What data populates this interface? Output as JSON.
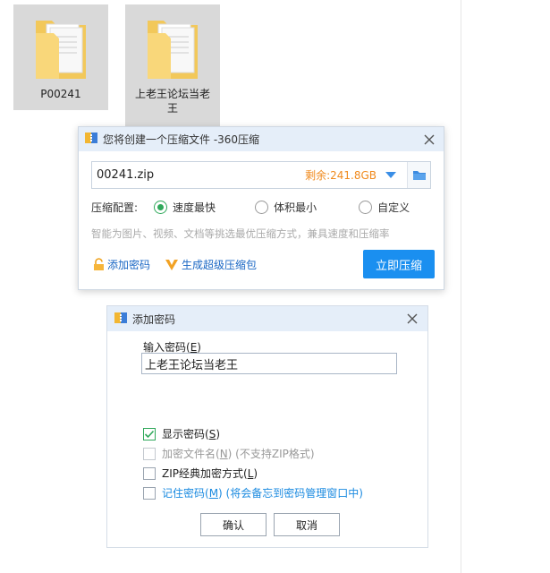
{
  "desktop": {
    "files": [
      {
        "label": "P00241",
        "icon": "folder-icon"
      },
      {
        "label": "上老王论坛当老王",
        "icon": "folder-icon"
      }
    ]
  },
  "zip_dialog": {
    "title": "您将创建一个压缩文件 -360压缩",
    "filename": "00241.zip",
    "free_space": "剩余:241.8GB",
    "config_label": "压缩配置:",
    "options": [
      "速度最快",
      "体积最小",
      "自定义"
    ],
    "selected_option": "速度最快",
    "hint": "智能为图片、视频、文档等挑选最优压缩方式，兼具速度和压缩率",
    "add_password_label": "添加密码",
    "super_zip_label": "生成超级压缩包",
    "compress_button": "立即压缩",
    "colors": {
      "accent": "#1a8ff0",
      "free_space": "#f08a1d",
      "radio_on": "#2fa85a"
    }
  },
  "password_dialog": {
    "title": "添加密码",
    "input_label": "输入密码(",
    "input_label_key": "E",
    "input_label_end": ")",
    "password_value": "上老王论坛当老王",
    "checkboxes": [
      {
        "text": "显示密码(",
        "key": "S",
        "end": ")",
        "suffix": "",
        "checked": true,
        "disabled": false
      },
      {
        "text": "加密文件名(",
        "key": "N",
        "end": ")",
        "suffix": " (不支持ZIP格式)",
        "checked": false,
        "disabled": true
      },
      {
        "text": "ZIP经典加密方式(",
        "key": "L",
        "end": ")",
        "suffix": "",
        "checked": false,
        "disabled": false
      },
      {
        "text": "记住密码(",
        "key": "M",
        "end": ")",
        "suffix": " (将会备忘到密码管理窗口中)",
        "checked": false,
        "disabled": false
      }
    ],
    "ok_button": "确认",
    "cancel_button": "取消"
  }
}
